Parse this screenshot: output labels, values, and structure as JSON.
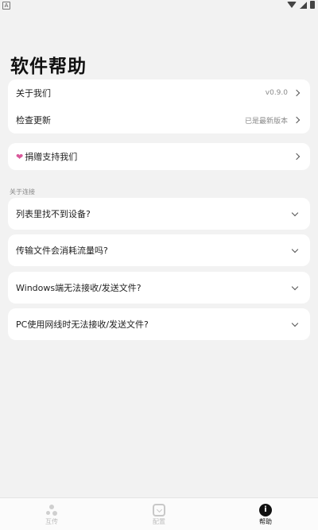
{
  "page": {
    "title": "软件帮助"
  },
  "info_card": {
    "about": {
      "label": "关于我们",
      "value": "v0.9.0"
    },
    "update": {
      "label": "检查更新",
      "value": "已是最新版本"
    }
  },
  "donate": {
    "label": "捐赠支持我们"
  },
  "section": {
    "label": "关于连接"
  },
  "faq": [
    {
      "question": "列表里找不到设备?"
    },
    {
      "question": "传输文件会消耗流量吗?"
    },
    {
      "question": "Windows端无法接收/发送文件?"
    },
    {
      "question": "PC使用网线时无法接收/发送文件?"
    }
  ],
  "bottom_nav": [
    {
      "label": "互传",
      "icon": "dots-icon",
      "active": false
    },
    {
      "label": "配置",
      "icon": "cube-icon",
      "active": false
    },
    {
      "label": "帮助",
      "icon": "info-icon",
      "active": true
    }
  ],
  "status_bar": {
    "left_icon": "A"
  }
}
